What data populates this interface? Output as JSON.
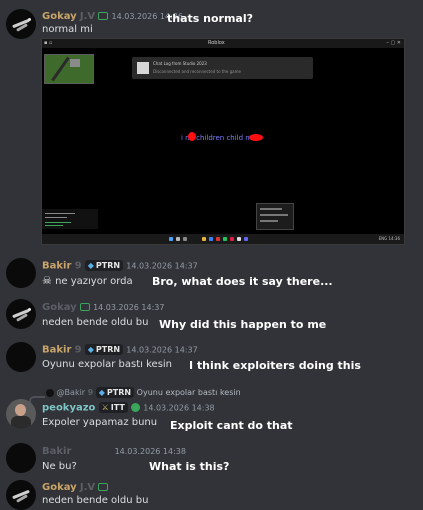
{
  "colors": {
    "background": "#313338",
    "username": "#c9a56a",
    "reply_username": "#c9a56a",
    "annotation": "#ffffff",
    "timestamp": "#949ba4",
    "badge_green": "#3ba55c",
    "screenshot_text": "#7d7dff",
    "redaction": "#ff1010"
  },
  "messages": [
    {
      "author": "Gokay",
      "author_hidden": "J.V",
      "timestamp": "14.03.2026 14:36",
      "text": "normal mi",
      "annotation": "thats normal?",
      "screenshot": {
        "window_title": "Roblox",
        "notification_line1": "Chat Log from Studio 2023",
        "notification_line2": "Disconnected and reconnected to the game",
        "center_text": "i ne children child n",
        "icons": [
          "windows-start-icon",
          "search-icon",
          "taskview-icon",
          "browser-icon",
          "folder-icon",
          "store-icon",
          "mail-icon",
          "settings-icon",
          "game-icon",
          "discord-icon"
        ],
        "tray": "ENG 14:36"
      }
    },
    {
      "author": "Bakir",
      "author_hidden": "9",
      "tag": "PTRN",
      "timestamp": "14.03.2026 14:37",
      "text": "ne yazıyor orda",
      "icon": "skull-icon",
      "annotation": "Bro, what does it say there..."
    },
    {
      "author_hidden": "Gokay",
      "timestamp": "14.03.2026 14:37",
      "text": "neden bende oldu bu",
      "annotation": "Why did this happen to me"
    },
    {
      "author": "Bakir",
      "author_hidden": "9",
      "tag": "PTRN",
      "timestamp": "14.03.2026 14:37",
      "text": "Oyunu expolar bastı kesin",
      "annotation": "I think exploiters doing this"
    },
    {
      "reply": {
        "author": "@Bakir",
        "author_hidden": "9",
        "tag": "PTRN",
        "text": "Oyunu expolar bastı kesin"
      },
      "author": "peokyazo",
      "tag": "ITT",
      "timestamp": "14.03.2026 14:38",
      "text": "Expoler yapamaz bunu",
      "annotation": "Exploit cant do that"
    },
    {
      "author_hidden": "Bakir",
      "timestamp": "14.03.2026 14:38",
      "text": "Ne bu?",
      "annotation": "What is this?"
    },
    {
      "author": "Gokay",
      "author_hidden": "J.V",
      "text": "neden bende oldu bu"
    }
  ]
}
